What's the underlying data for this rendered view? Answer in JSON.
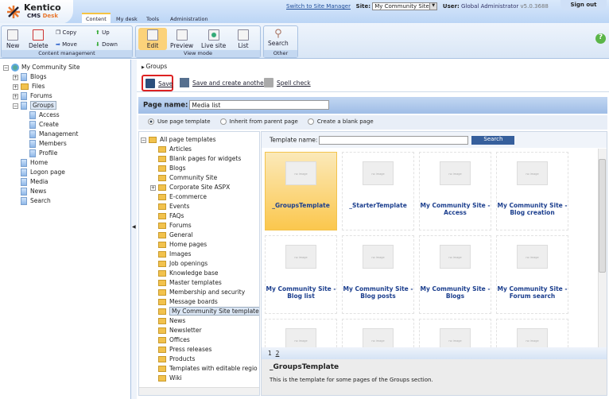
{
  "header": {
    "logo_top": "Kentico",
    "logo_cms": "CMS",
    "logo_desk": "Desk",
    "tabs": [
      "Content",
      "My desk",
      "Tools",
      "Administration"
    ],
    "switch_link": "Switch to Site Manager",
    "site_label": "Site:",
    "site_value": "My Community Site",
    "user_label": "User:",
    "user_value": "Global Administrator",
    "version": "v5.0.3688",
    "sign_out": "Sign out"
  },
  "toolbar": {
    "content_mgmt": {
      "label": "Content management",
      "new": "New",
      "delete": "Delete",
      "copy": "Copy",
      "move": "Move",
      "up": "Up",
      "down": "Down"
    },
    "view_mode": {
      "label": "View mode",
      "edit": "Edit",
      "preview": "Preview",
      "live_site": "Live site",
      "list": "List"
    },
    "other": {
      "label": "Other",
      "search": "Search"
    }
  },
  "tree": {
    "root": "My Community Site",
    "items": [
      {
        "label": "Blogs",
        "level": 1,
        "exp": "+",
        "folder": false
      },
      {
        "label": "Files",
        "level": 1,
        "exp": "+",
        "folder": true
      },
      {
        "label": "Forums",
        "level": 1,
        "exp": "+",
        "folder": false
      },
      {
        "label": "Groups",
        "level": 1,
        "exp": "-",
        "folder": false,
        "selected": true
      },
      {
        "label": "Access",
        "level": 2
      },
      {
        "label": "Create",
        "level": 2
      },
      {
        "label": "Management",
        "level": 2
      },
      {
        "label": "Members",
        "level": 2
      },
      {
        "label": "Profile",
        "level": 2
      },
      {
        "label": "Home",
        "level": 1
      },
      {
        "label": "Logon page",
        "level": 1
      },
      {
        "label": "Media",
        "level": 1
      },
      {
        "label": "News",
        "level": 1
      },
      {
        "label": "Search",
        "level": 1
      }
    ]
  },
  "breadcrumb": "Groups",
  "actions": {
    "save": "Save",
    "save_another": "Save and create another",
    "spell": "Spell check"
  },
  "page_name": {
    "label": "Page name:",
    "value": "Media list"
  },
  "radios": {
    "options": [
      "Use page template",
      "Inherit from parent page",
      "Create a blank page"
    ],
    "selected": 0
  },
  "template_tree": {
    "root": "All page templates",
    "items": [
      "Articles",
      "Blank pages for widgets",
      "Blogs",
      "Community Site",
      "Corporate Site ASPX",
      "E-commerce",
      "Events",
      "FAQs",
      "Forums",
      "General",
      "Home pages",
      "Images",
      "Job openings",
      "Knowledge base",
      "Master templates",
      "Membership and security",
      "Message boards",
      "My Community Site templates",
      "News",
      "Newsletter",
      "Offices",
      "Press releases",
      "Products",
      "Templates with editable regio",
      "Wiki"
    ],
    "selected": "My Community Site templates"
  },
  "search": {
    "label": "Template name:",
    "value": "",
    "button": "Search"
  },
  "tiles": {
    "no_image": "no image",
    "items": [
      "_GroupsTemplate",
      "_StarterTemplate",
      "My Community Site - Access",
      "My Community Site - Blog creation",
      "My Community Site - Blog list",
      "My Community Site - Blog posts",
      "My Community Site - Blogs",
      "My Community Site - Forum search"
    ],
    "selected": 0
  },
  "pager": {
    "pages": [
      "1",
      "2"
    ],
    "current": "1"
  },
  "description": {
    "title": "_GroupsTemplate",
    "text": "This is the template for some pages of the Groups section."
  }
}
